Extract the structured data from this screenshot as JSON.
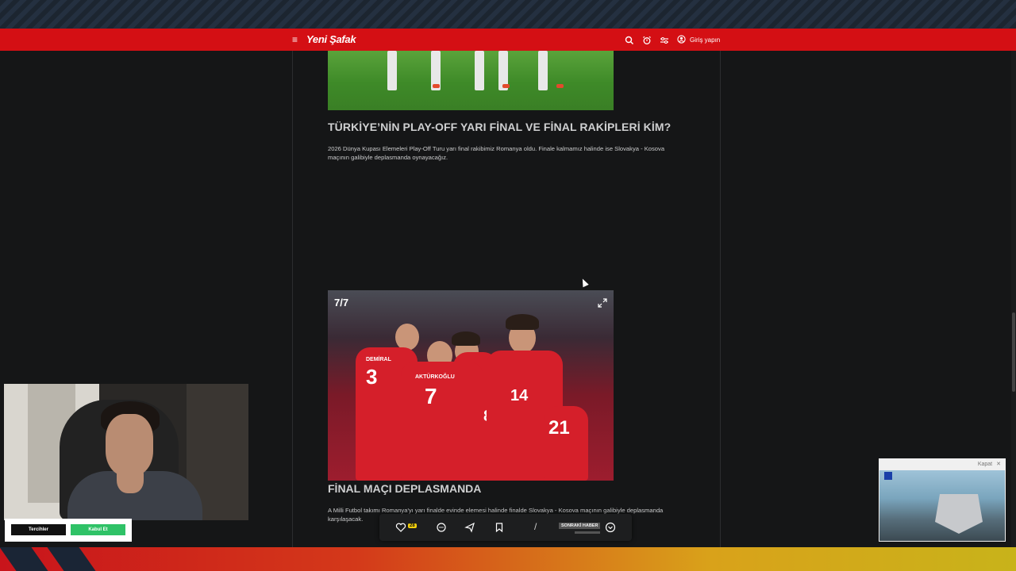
{
  "header": {
    "logo": "Yeni Şafak",
    "login_label": "Giriş yapın",
    "icons": [
      "menu-icon",
      "search-icon",
      "alarm-icon",
      "filter-icon",
      "user-icon"
    ],
    "accent_color": "#d40f14"
  },
  "article": {
    "section1": {
      "title": "TÜRKİYE’NİN PLAY-OFF YARI FİNAL VE FİNAL RAKİPLERİ KİM?",
      "body": "2026 Dünya Kupası Elemeleri Play-Off Turu yarı final rakibimiz Romanya oldu. Finale kalmamız halinde ise Slovakya - Kosova maçının galibiyle deplasmanda oynayacağız."
    },
    "gallery": {
      "counter": "7/7",
      "jersey_names": [
        "DEMİRAL",
        "AKTÜRKOĞLU"
      ],
      "jersey_numbers": [
        "3",
        "7",
        "14",
        "21",
        "8"
      ]
    },
    "section2": {
      "title": "FİNAL MAÇI DEPLASMANDA",
      "body": "A Milli Futbol takımı Romanya'yı yarı finalde evinde elemesi halinde finalde Slovakya - Kosova maçının galibiyle deplasmanda karşılaşacak."
    }
  },
  "action_bar": {
    "like_count": "28",
    "divider": "/",
    "next_news_label": "SONRAKİ HABER",
    "icons": [
      "heart-icon",
      "comment-icon",
      "share-icon",
      "bookmark-icon",
      "chevron-down-icon"
    ]
  },
  "consent": {
    "preferences_label": "Tercihler",
    "accept_label": "Kabul Et",
    "accept_color": "#2fc267"
  },
  "video_ad": {
    "close_label": "Kapat",
    "close_icon": "close-icon"
  }
}
